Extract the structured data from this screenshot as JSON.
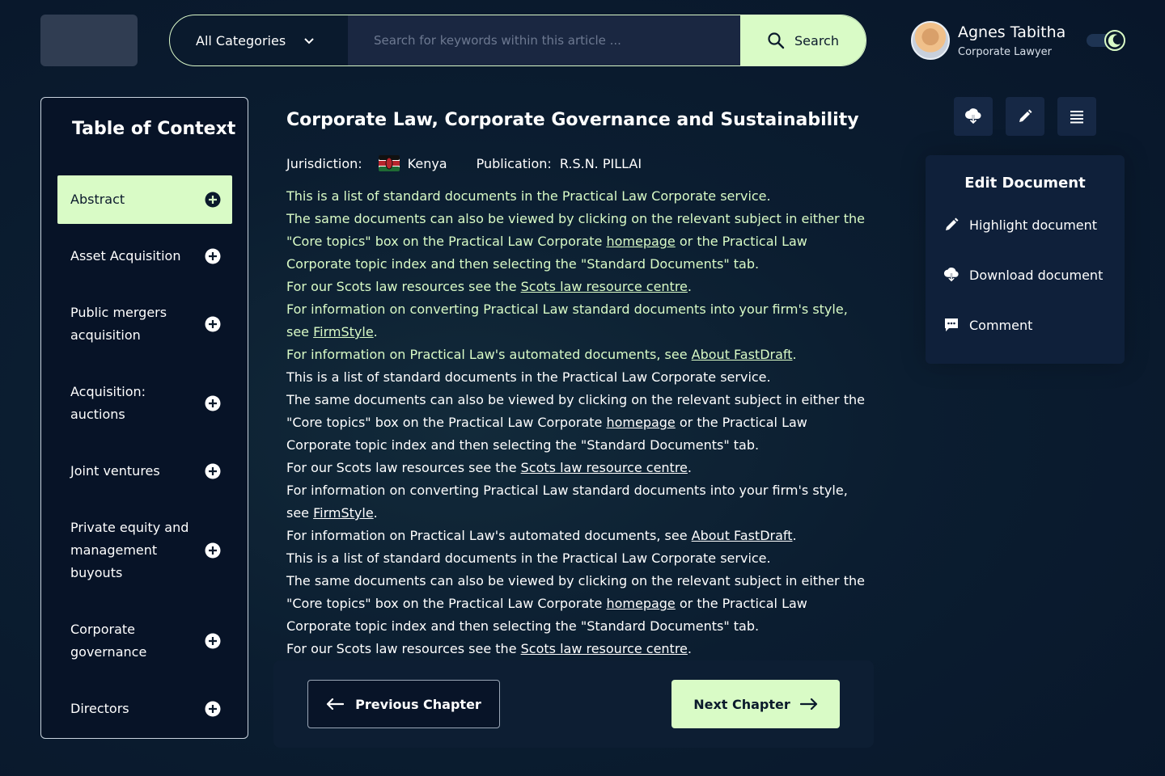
{
  "header": {
    "search": {
      "category": "All Categories",
      "placeholder": "Search for keywords within this article ...",
      "value": "",
      "button_label": "Search"
    },
    "user": {
      "name": "Agnes Tabitha",
      "role": "Corporate Lawyer"
    }
  },
  "toc": {
    "title": "Table of Context",
    "items": [
      {
        "label": "Abstract",
        "active": true
      },
      {
        "label": "Asset Acquisition"
      },
      {
        "label": "Public mergers acquisition"
      },
      {
        "label": "Acquisition: auctions"
      },
      {
        "label": "Joint ventures"
      },
      {
        "label": "Private equity and management buyouts"
      },
      {
        "label": "Corporate governance"
      },
      {
        "label": "Directors"
      }
    ]
  },
  "article": {
    "title": "Corporate Law, Corporate Governance and Sustainability",
    "jurisdiction_label": "Jurisdiction:",
    "jurisdiction_value": "Kenya",
    "publication_label": "Publication:",
    "publication_value": "R.S.N. PILLAI",
    "block": {
      "line1": "This is a list of standard documents in the Practical Law Corporate service.",
      "line2a": "The same documents can also be viewed by clicking on the relevant subject in either the \"Core topics\" box on the Practical Law Corporate ",
      "line2_link": "homepage",
      "line2b": " or the Practical Law Corporate topic index and then selecting the \"Standard Documents\" tab.",
      "line3a": "For our Scots law resources see the ",
      "line3_link": "Scots law resource centre",
      "line3b": ".",
      "line4a": "For information on converting Practical Law standard documents into your firm's style, see ",
      "line4_link": "FirmStyle",
      "line4b": ".",
      "line5a": "For information on Practical Law's automated documents, see ",
      "line5_link": "About FastDraft",
      "line5b": "."
    }
  },
  "chapter_nav": {
    "previous": "Previous Chapter",
    "next": "Next Chapter"
  },
  "tools": {
    "icons": [
      "download-cloud-icon",
      "pencil-icon",
      "list-icon"
    ]
  },
  "edit_panel": {
    "title": "Edit Document",
    "items": [
      {
        "label": "Highlight document",
        "icon": "pencil-icon"
      },
      {
        "label": "Download document",
        "icon": "download-cloud-icon"
      },
      {
        "label": "Comment",
        "icon": "comment-icon"
      }
    ]
  },
  "colors": {
    "accent": "#d9fbc6",
    "background": "#0b1d30",
    "panel": "#0f203a"
  }
}
